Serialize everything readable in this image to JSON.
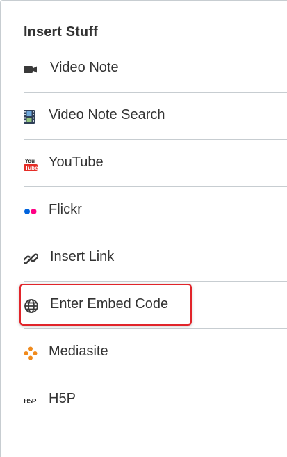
{
  "panel": {
    "heading": "Insert Stuff",
    "items": [
      {
        "label": "Video Note",
        "icon": "video-camera-icon"
      },
      {
        "label": "Video Note Search",
        "icon": "film-strip-icon"
      },
      {
        "label": "YouTube",
        "icon": "youtube-icon"
      },
      {
        "label": "Flickr",
        "icon": "flickr-icon"
      },
      {
        "label": "Insert Link",
        "icon": "link-icon"
      },
      {
        "label": "Enter Embed Code",
        "icon": "globe-icon",
        "highlighted": true
      },
      {
        "label": "Mediasite",
        "icon": "mediasite-icon"
      },
      {
        "label": "H5P",
        "icon": "h5p-icon"
      }
    ]
  },
  "colors": {
    "text": "#333333",
    "divider": "#c7cdd1",
    "highlight_border": "#e1242a",
    "flickr_blue": "#0063dc",
    "flickr_pink": "#ff0084",
    "youtube_red": "#e52d27",
    "mediasite_orange": "#f08a1c"
  }
}
